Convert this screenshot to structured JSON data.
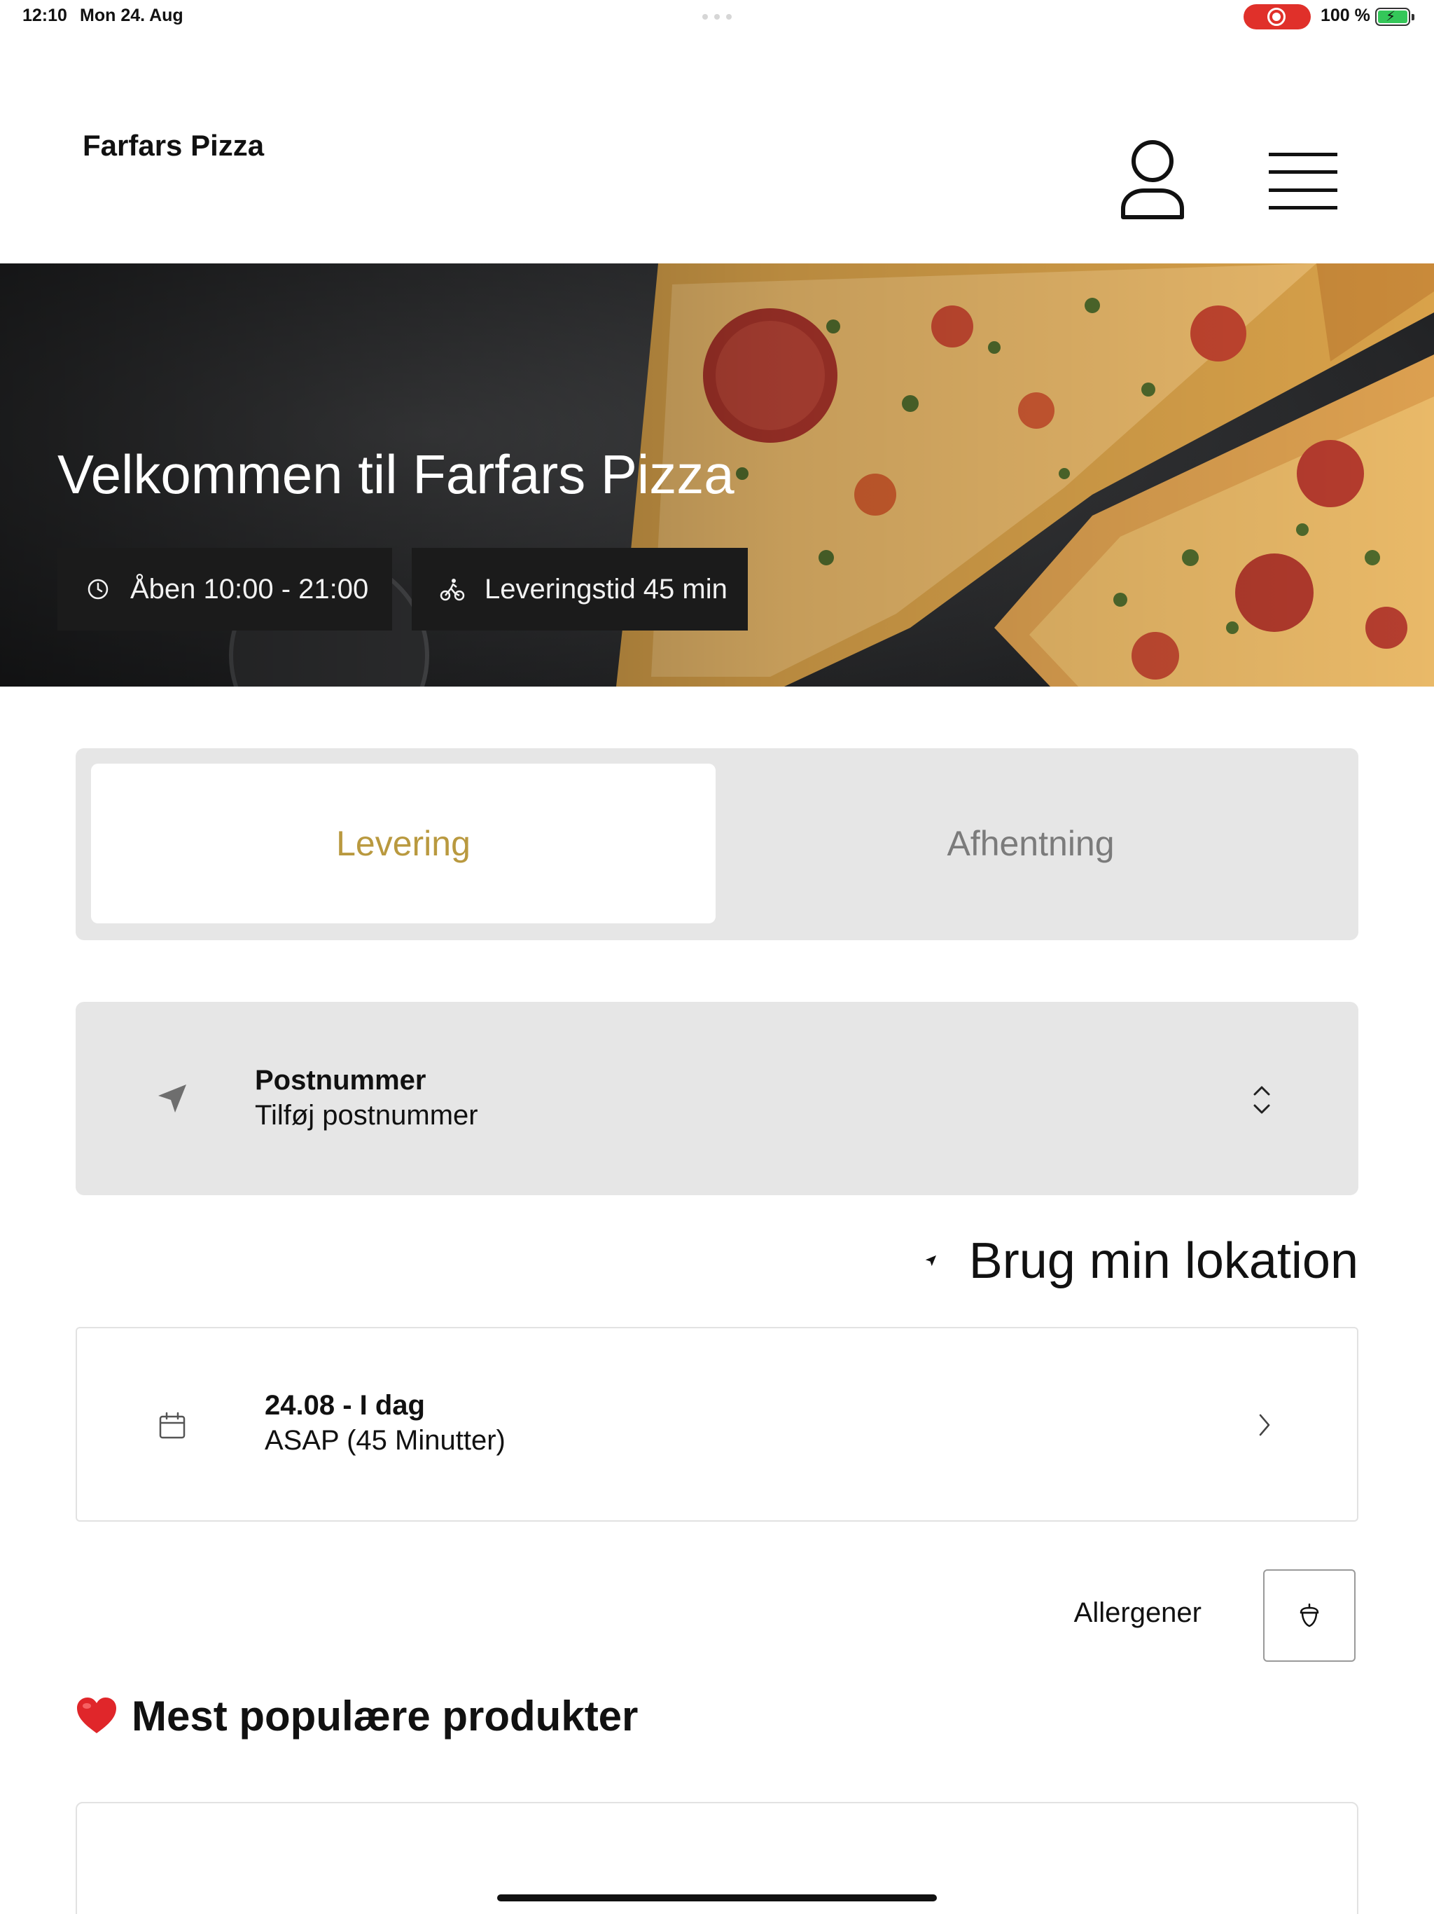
{
  "status_bar": {
    "time": "12:10",
    "date": "Mon 24. Aug",
    "battery": "100 %",
    "battery_level": 1.0,
    "recording_color": "#e0302a"
  },
  "header": {
    "brand": "Farfars Pizza",
    "icons": {
      "user": "user-icon",
      "menu": "menu-icon"
    }
  },
  "hero": {
    "title": "Velkommen til Farfars Pizza",
    "opening_hours": "Åben 10:00 - 21:00",
    "delivery_time": "Leveringstid 45 min",
    "icons": {
      "clock": "clock-icon",
      "bike": "bike-icon"
    }
  },
  "order_mode": {
    "tabs": [
      {
        "label": "Levering",
        "selected": true
      },
      {
        "label": "Afhentning",
        "selected": false
      }
    ],
    "accent_color": "#b9993f"
  },
  "postcode": {
    "label": "Postnummer",
    "placeholder": "Tilføj postnummer",
    "icon": "location-arrow-icon"
  },
  "use_location": {
    "label": "Brug min lokation"
  },
  "schedule": {
    "date_label": "24.08 - I dag",
    "time_label": "ASAP (45 Minutter)",
    "icon": "calendar-icon"
  },
  "allergens": {
    "label": "Allergener",
    "icon": "acorn-icon"
  },
  "popular": {
    "heading": "Mest populære produkter",
    "icon": "heart-icon"
  }
}
